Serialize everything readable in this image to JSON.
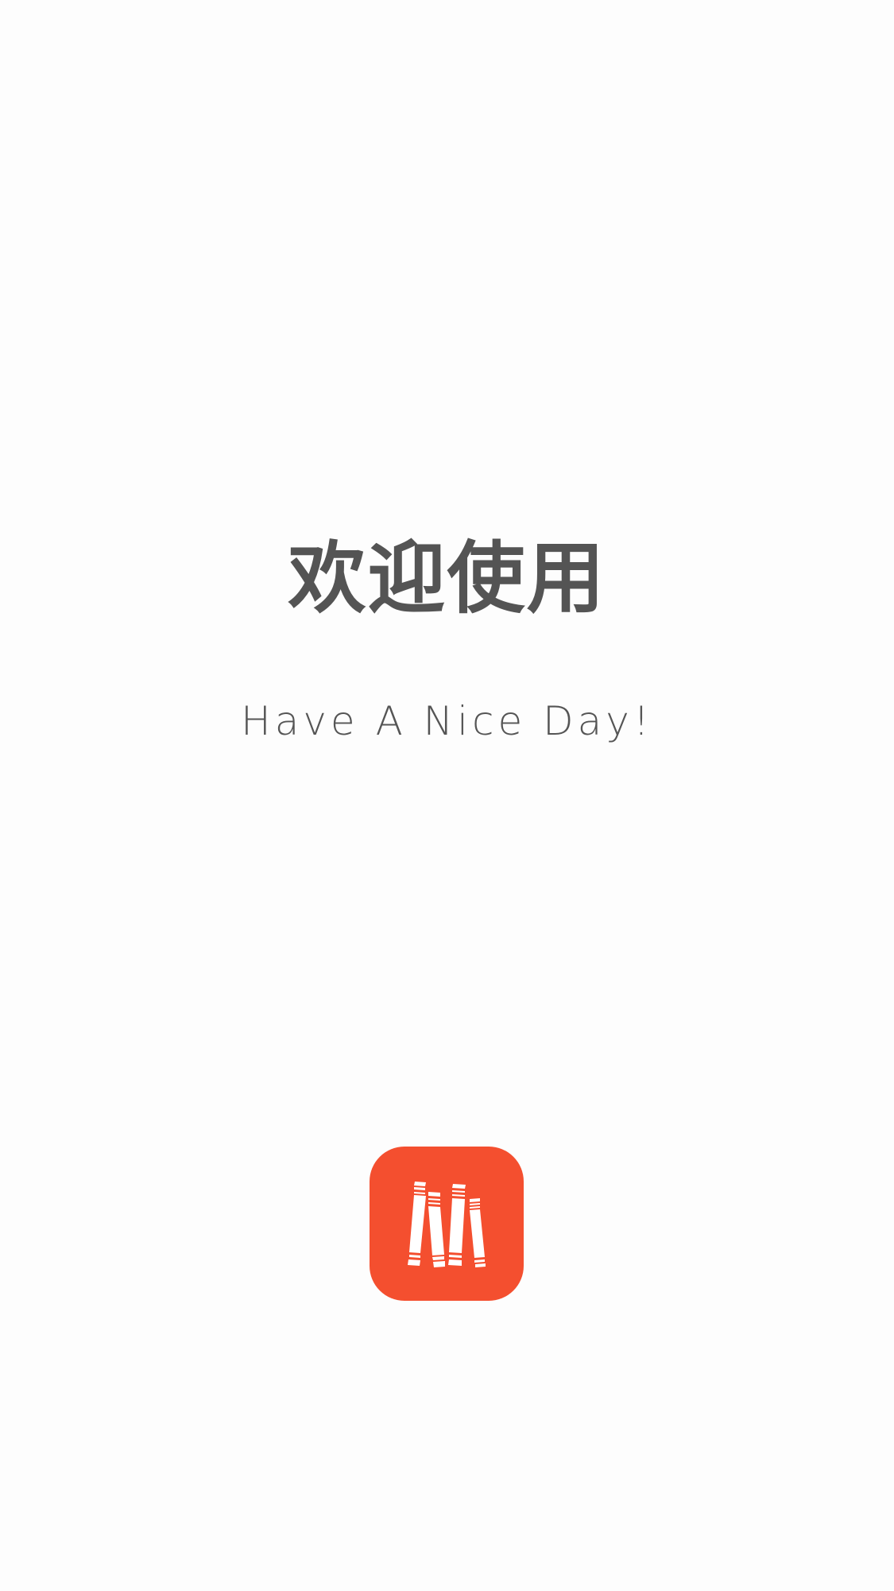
{
  "splash": {
    "title": "欢迎使用",
    "subtitle": "Have A Nice Day!",
    "logo_icon": "books-icon",
    "accent_color": "#f44f2f",
    "text_color": "#545454",
    "background_color": "#fdfdfd"
  }
}
